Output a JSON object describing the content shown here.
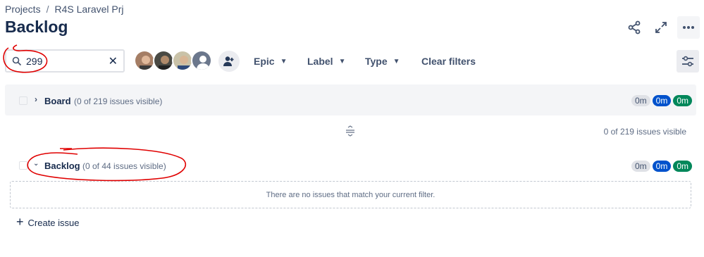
{
  "breadcrumb": {
    "projects": "Projects",
    "separator": "/",
    "project": "R4S Laravel Prj"
  },
  "page": {
    "title": "Backlog"
  },
  "search": {
    "value": "299",
    "clear_icon": "close-icon"
  },
  "filters": {
    "epic": "Epic",
    "label": "Label",
    "type": "Type",
    "clear": "Clear filters"
  },
  "board_section": {
    "title": "Board",
    "count": "(0 of 219 issues visible)",
    "pills": [
      "0m",
      "0m",
      "0m"
    ]
  },
  "divider": {
    "visible_count": "0 of 219 issues visible"
  },
  "backlog_section": {
    "title": "Backlog",
    "count": "(0 of 44 issues visible)",
    "pills": [
      "0m",
      "0m",
      "0m"
    ]
  },
  "empty_state": {
    "message": "There are no issues that match your current filter."
  },
  "create_issue": {
    "label": "Create issue"
  },
  "colors": {
    "primary_text": "#172b4d",
    "blue_pill": "#0052cc",
    "green_pill": "#00875a",
    "annotation_red": "#e00000"
  }
}
